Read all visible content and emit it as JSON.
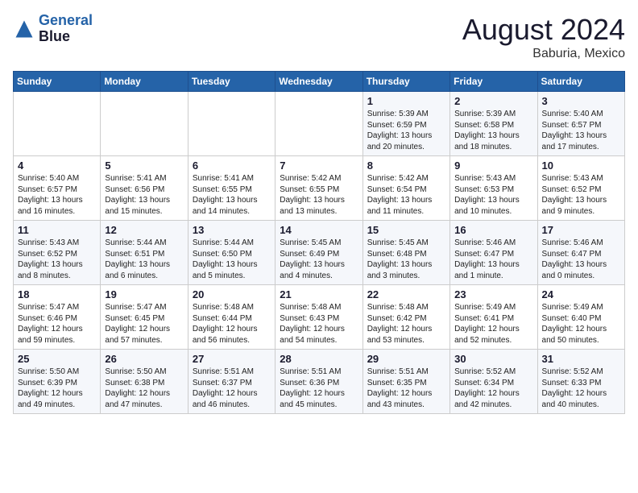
{
  "header": {
    "logo_line1": "General",
    "logo_line2": "Blue",
    "month_year": "August 2024",
    "location": "Baburia, Mexico"
  },
  "days_of_week": [
    "Sunday",
    "Monday",
    "Tuesday",
    "Wednesday",
    "Thursday",
    "Friday",
    "Saturday"
  ],
  "weeks": [
    [
      {
        "num": "",
        "info": ""
      },
      {
        "num": "",
        "info": ""
      },
      {
        "num": "",
        "info": ""
      },
      {
        "num": "",
        "info": ""
      },
      {
        "num": "1",
        "info": "Sunrise: 5:39 AM\nSunset: 6:59 PM\nDaylight: 13 hours\nand 20 minutes."
      },
      {
        "num": "2",
        "info": "Sunrise: 5:39 AM\nSunset: 6:58 PM\nDaylight: 13 hours\nand 18 minutes."
      },
      {
        "num": "3",
        "info": "Sunrise: 5:40 AM\nSunset: 6:57 PM\nDaylight: 13 hours\nand 17 minutes."
      }
    ],
    [
      {
        "num": "4",
        "info": "Sunrise: 5:40 AM\nSunset: 6:57 PM\nDaylight: 13 hours\nand 16 minutes."
      },
      {
        "num": "5",
        "info": "Sunrise: 5:41 AM\nSunset: 6:56 PM\nDaylight: 13 hours\nand 15 minutes."
      },
      {
        "num": "6",
        "info": "Sunrise: 5:41 AM\nSunset: 6:55 PM\nDaylight: 13 hours\nand 14 minutes."
      },
      {
        "num": "7",
        "info": "Sunrise: 5:42 AM\nSunset: 6:55 PM\nDaylight: 13 hours\nand 13 minutes."
      },
      {
        "num": "8",
        "info": "Sunrise: 5:42 AM\nSunset: 6:54 PM\nDaylight: 13 hours\nand 11 minutes."
      },
      {
        "num": "9",
        "info": "Sunrise: 5:43 AM\nSunset: 6:53 PM\nDaylight: 13 hours\nand 10 minutes."
      },
      {
        "num": "10",
        "info": "Sunrise: 5:43 AM\nSunset: 6:52 PM\nDaylight: 13 hours\nand 9 minutes."
      }
    ],
    [
      {
        "num": "11",
        "info": "Sunrise: 5:43 AM\nSunset: 6:52 PM\nDaylight: 13 hours\nand 8 minutes."
      },
      {
        "num": "12",
        "info": "Sunrise: 5:44 AM\nSunset: 6:51 PM\nDaylight: 13 hours\nand 6 minutes."
      },
      {
        "num": "13",
        "info": "Sunrise: 5:44 AM\nSunset: 6:50 PM\nDaylight: 13 hours\nand 5 minutes."
      },
      {
        "num": "14",
        "info": "Sunrise: 5:45 AM\nSunset: 6:49 PM\nDaylight: 13 hours\nand 4 minutes."
      },
      {
        "num": "15",
        "info": "Sunrise: 5:45 AM\nSunset: 6:48 PM\nDaylight: 13 hours\nand 3 minutes."
      },
      {
        "num": "16",
        "info": "Sunrise: 5:46 AM\nSunset: 6:47 PM\nDaylight: 13 hours\nand 1 minute."
      },
      {
        "num": "17",
        "info": "Sunrise: 5:46 AM\nSunset: 6:47 PM\nDaylight: 13 hours\nand 0 minutes."
      }
    ],
    [
      {
        "num": "18",
        "info": "Sunrise: 5:47 AM\nSunset: 6:46 PM\nDaylight: 12 hours\nand 59 minutes."
      },
      {
        "num": "19",
        "info": "Sunrise: 5:47 AM\nSunset: 6:45 PM\nDaylight: 12 hours\nand 57 minutes."
      },
      {
        "num": "20",
        "info": "Sunrise: 5:48 AM\nSunset: 6:44 PM\nDaylight: 12 hours\nand 56 minutes."
      },
      {
        "num": "21",
        "info": "Sunrise: 5:48 AM\nSunset: 6:43 PM\nDaylight: 12 hours\nand 54 minutes."
      },
      {
        "num": "22",
        "info": "Sunrise: 5:48 AM\nSunset: 6:42 PM\nDaylight: 12 hours\nand 53 minutes."
      },
      {
        "num": "23",
        "info": "Sunrise: 5:49 AM\nSunset: 6:41 PM\nDaylight: 12 hours\nand 52 minutes."
      },
      {
        "num": "24",
        "info": "Sunrise: 5:49 AM\nSunset: 6:40 PM\nDaylight: 12 hours\nand 50 minutes."
      }
    ],
    [
      {
        "num": "25",
        "info": "Sunrise: 5:50 AM\nSunset: 6:39 PM\nDaylight: 12 hours\nand 49 minutes."
      },
      {
        "num": "26",
        "info": "Sunrise: 5:50 AM\nSunset: 6:38 PM\nDaylight: 12 hours\nand 47 minutes."
      },
      {
        "num": "27",
        "info": "Sunrise: 5:51 AM\nSunset: 6:37 PM\nDaylight: 12 hours\nand 46 minutes."
      },
      {
        "num": "28",
        "info": "Sunrise: 5:51 AM\nSunset: 6:36 PM\nDaylight: 12 hours\nand 45 minutes."
      },
      {
        "num": "29",
        "info": "Sunrise: 5:51 AM\nSunset: 6:35 PM\nDaylight: 12 hours\nand 43 minutes."
      },
      {
        "num": "30",
        "info": "Sunrise: 5:52 AM\nSunset: 6:34 PM\nDaylight: 12 hours\nand 42 minutes."
      },
      {
        "num": "31",
        "info": "Sunrise: 5:52 AM\nSunset: 6:33 PM\nDaylight: 12 hours\nand 40 minutes."
      }
    ]
  ]
}
